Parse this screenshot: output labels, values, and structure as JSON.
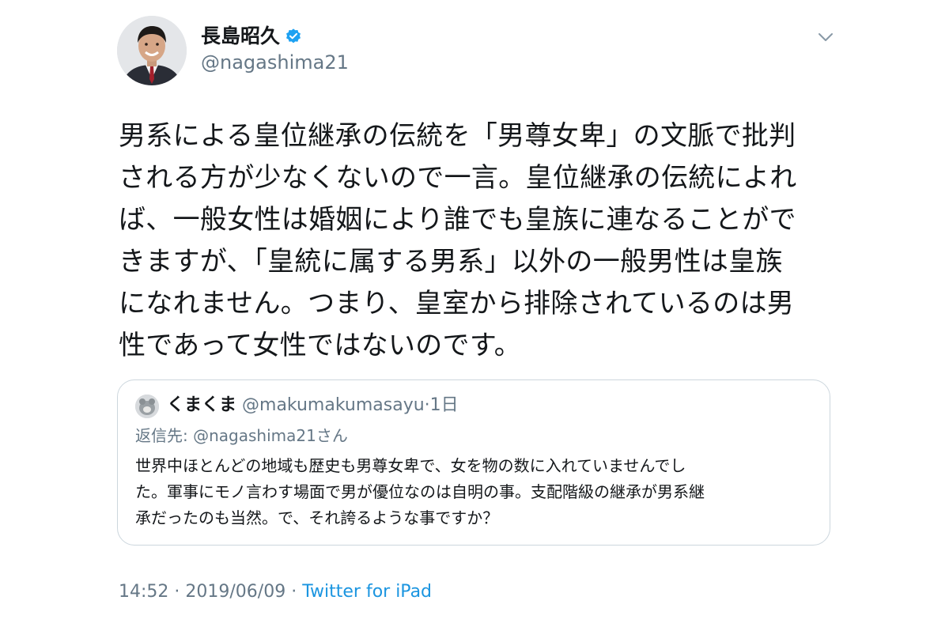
{
  "author": {
    "name": "長島昭久",
    "handle": "@nagashima21",
    "verified_color": "#1da1f2"
  },
  "tweet": {
    "lines": [
      "男系による皇位継承の伝統を「男尊女卑」の文脈で批判",
      "される方が少なくないので一言。皇位継承の伝統によれ",
      "ば、一般女性は婚姻により誰でも皇族に連なることがで",
      "きますが、「皇統に属する男系」以外の一般男性は皇族",
      "になれません。つまり、皇室から排除されているのは男",
      "性であって女性ではないのです。"
    ]
  },
  "quote": {
    "name": "くまくま",
    "handle": "@makumakumasayu",
    "separator": "·",
    "time": "1日",
    "reply_to": "返信先: @nagashima21さん",
    "lines": [
      "世界中ほとんどの地域も歴史も男尊女卑で、女を物の数に入れていませんでし",
      "た。軍事にモノ言わす場面で男が優位なのは自明の事。支配階級の継承が男系継",
      "承だったのも当然。で、それ誇るような事ですか？"
    ]
  },
  "meta": {
    "time": "14:52",
    "sep1": "·",
    "date": "2019/06/09",
    "sep2": "·",
    "source": "Twitter for iPad"
  },
  "icons": {
    "chevron": "chevron-down-icon",
    "verified": "verified-badge-icon"
  }
}
